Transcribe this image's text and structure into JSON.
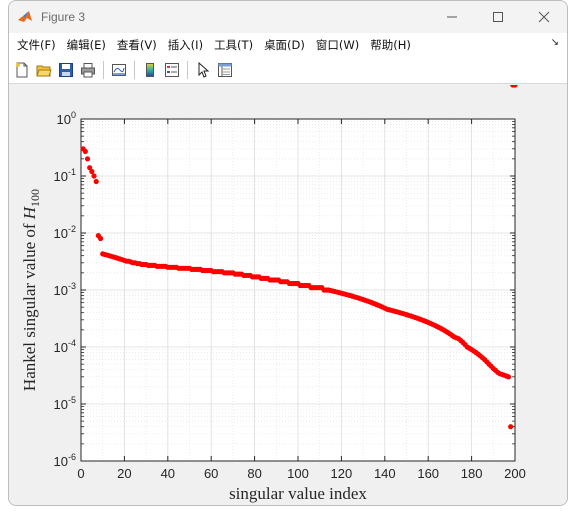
{
  "window": {
    "title": "Figure 3",
    "menu": [
      "文件(F)",
      "编辑(E)",
      "查看(V)",
      "插入(I)",
      "工具(T)",
      "桌面(D)",
      "窗口(W)",
      "帮助(H)"
    ],
    "toolbar_icons": [
      "new-figure-icon",
      "open-file-icon",
      "save-icon",
      "print-icon",
      "link-plot-icon",
      "insert-colorbar-icon",
      "insert-legend-icon",
      "edit-plot-icon",
      "property-inspector-icon"
    ]
  },
  "chart_data": {
    "type": "scatter",
    "xlabel": "singular value index",
    "ylabel_prefix": "Hankel singular value of ",
    "ylabel_symbol": "H",
    "ylabel_subscript": "100",
    "xlim": [
      0,
      200
    ],
    "ylim": [
      1e-06,
      1
    ],
    "yscale": "log",
    "grid": true,
    "minor_grid": true,
    "marker_color": "#ff0000",
    "x_ticks": [
      0,
      20,
      40,
      60,
      80,
      100,
      120,
      140,
      160,
      180,
      200
    ],
    "x_tick_labels": [
      "0",
      "20",
      "40",
      "60",
      "80",
      "100",
      "120",
      "140",
      "160",
      "180",
      "200"
    ],
    "y_ticks": [
      1e-06,
      1e-05,
      0.0001,
      0.001,
      0.01,
      0.1,
      1
    ],
    "y_tick_bases": [
      "10",
      "10",
      "10",
      "10",
      "10",
      "10",
      "10"
    ],
    "y_tick_exponents": [
      "-6",
      "-5",
      "-4",
      "-3",
      "-2",
      "-1",
      "0"
    ],
    "x": [
      1,
      2,
      3,
      4,
      5,
      6,
      7,
      8,
      9,
      10,
      11,
      12,
      13,
      14,
      15,
      16,
      17,
      18,
      19,
      20,
      21,
      22,
      23,
      24,
      25,
      26,
      27,
      28,
      29,
      30,
      31,
      32,
      33,
      34,
      35,
      36,
      37,
      38,
      39,
      40,
      41,
      42,
      43,
      44,
      45,
      46,
      47,
      48,
      49,
      50,
      51,
      52,
      53,
      54,
      55,
      56,
      57,
      58,
      59,
      60,
      61,
      62,
      63,
      64,
      65,
      66,
      67,
      68,
      69,
      70,
      71,
      72,
      73,
      74,
      75,
      76,
      77,
      78,
      79,
      80,
      81,
      82,
      83,
      84,
      85,
      86,
      87,
      88,
      89,
      90,
      91,
      92,
      93,
      94,
      95,
      96,
      97,
      98,
      99,
      100,
      101,
      102,
      103,
      104,
      105,
      106,
      107,
      108,
      109,
      110,
      111,
      112,
      113,
      114,
      115,
      116,
      117,
      118,
      119,
      120,
      121,
      122,
      123,
      124,
      125,
      126,
      127,
      128,
      129,
      130,
      131,
      132,
      133,
      134,
      135,
      136,
      137,
      138,
      139,
      140,
      141,
      142,
      143,
      144,
      145,
      146,
      147,
      148,
      149,
      150,
      151,
      152,
      153,
      154,
      155,
      156,
      157,
      158,
      159,
      160,
      161,
      162,
      163,
      164,
      165,
      166,
      167,
      168,
      169,
      170,
      171,
      172,
      173,
      174,
      175,
      176,
      177,
      178,
      179,
      180,
      181,
      182,
      183,
      184,
      185,
      186,
      187,
      188,
      189,
      190,
      191,
      192,
      193,
      194,
      195,
      196,
      197,
      198,
      199,
      200
    ],
    "y": [
      0.3,
      0.27,
      0.2,
      0.14,
      0.12,
      0.1,
      0.08,
      0.009,
      0.008,
      0.0043,
      0.0042,
      0.0041,
      0.004,
      0.0039,
      0.0038,
      0.0037,
      0.0036,
      0.0035,
      0.0034,
      0.0033,
      0.0032,
      0.0032,
      0.0031,
      0.003,
      0.003,
      0.0029,
      0.0029,
      0.0028,
      0.0028,
      0.0028,
      0.0027,
      0.0027,
      0.0027,
      0.0027,
      0.0026,
      0.0026,
      0.0026,
      0.0026,
      0.0026,
      0.0025,
      0.0025,
      0.0025,
      0.0025,
      0.0025,
      0.0024,
      0.0024,
      0.0024,
      0.0024,
      0.0024,
      0.0024,
      0.0023,
      0.0023,
      0.0023,
      0.0023,
      0.0023,
      0.0022,
      0.0022,
      0.0022,
      0.0022,
      0.0022,
      0.0021,
      0.0021,
      0.0021,
      0.0021,
      0.0021,
      0.002,
      0.002,
      0.002,
      0.002,
      0.002,
      0.0019,
      0.0019,
      0.0019,
      0.0019,
      0.0018,
      0.0018,
      0.0018,
      0.0018,
      0.0017,
      0.0017,
      0.0017,
      0.0017,
      0.0016,
      0.0016,
      0.0016,
      0.0016,
      0.0015,
      0.0015,
      0.0015,
      0.0015,
      0.0015,
      0.0014,
      0.0014,
      0.0014,
      0.0014,
      0.0013,
      0.0013,
      0.0013,
      0.0013,
      0.0013,
      0.0012,
      0.0012,
      0.0012,
      0.0012,
      0.0012,
      0.0011,
      0.0011,
      0.0011,
      0.0011,
      0.0011,
      0.0011,
      0.001,
      0.001,
      0.001,
      0.00098,
      0.00096,
      0.00094,
      0.00092,
      0.0009,
      0.00088,
      0.00086,
      0.00084,
      0.00082,
      0.0008,
      0.00078,
      0.00076,
      0.00074,
      0.00072,
      0.0007,
      0.00068,
      0.00066,
      0.00064,
      0.00062,
      0.0006,
      0.00058,
      0.00056,
      0.00054,
      0.00052,
      0.0005,
      0.00048,
      0.00046,
      0.00045,
      0.00044,
      0.00043,
      0.00042,
      0.00041,
      0.0004,
      0.00039,
      0.00038,
      0.00037,
      0.00036,
      0.00035,
      0.00034,
      0.00033,
      0.00032,
      0.00031,
      0.0003,
      0.00029,
      0.00028,
      0.00027,
      0.00026,
      0.00025,
      0.00024,
      0.00023,
      0.00022,
      0.00021,
      0.0002,
      0.00019,
      0.00018,
      0.00017,
      0.00016,
      0.00015,
      0.000145,
      0.00014,
      0.00013,
      0.00012,
      0.00011,
      0.0001,
      9.5e-05,
      9e-05,
      8.5e-05,
      8e-05,
      7.5e-05,
      7e-05,
      6.5e-05,
      6e-05,
      5.5e-05,
      5e-05,
      4.6e-05,
      4.2e-05,
      3.9e-05,
      3.6e-05,
      3.4e-05,
      3.3e-05,
      3.2e-05,
      3.1e-05,
      3e-05,
      4e-06
    ]
  }
}
